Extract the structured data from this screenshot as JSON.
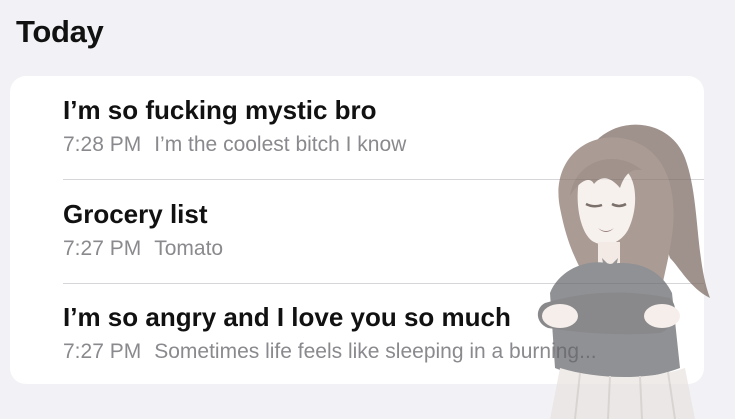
{
  "section": {
    "title": "Today"
  },
  "notes": [
    {
      "title": "I’m so fucking mystic bro",
      "time": "7:28 PM",
      "preview": "I’m the coolest bitch I know"
    },
    {
      "title": "Grocery list",
      "time": "7:27 PM",
      "preview": "Tomato"
    },
    {
      "title": "I’m so angry and I love you so much",
      "time": "7:27 PM",
      "preview": "Sometimes life feels like sleeping in a burning..."
    }
  ],
  "colors": {
    "background": "#f2f2f6",
    "card": "#ffffff",
    "title_text": "#111111",
    "secondary_text": "#8a8a8e"
  }
}
